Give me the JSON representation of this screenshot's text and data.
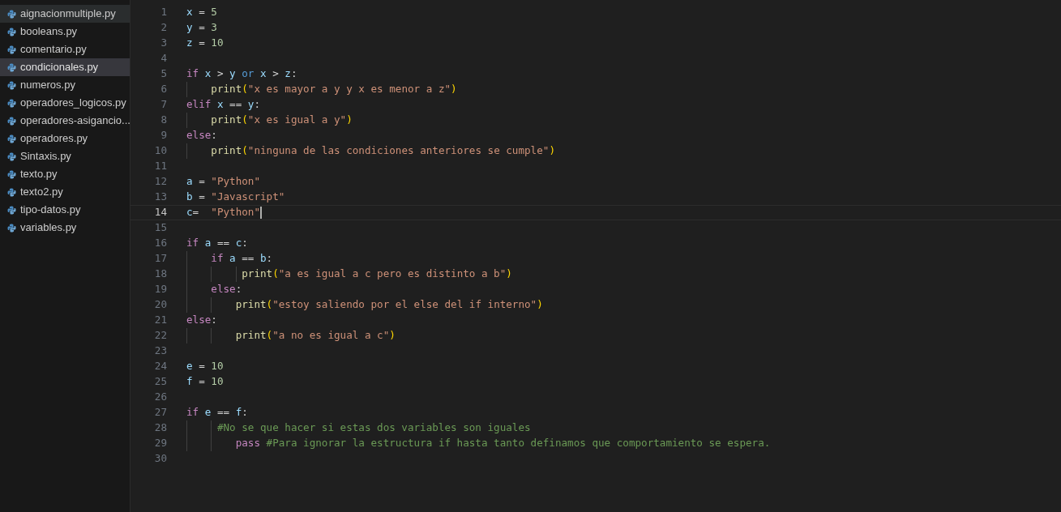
{
  "explorer": {
    "files": [
      {
        "name": "aignacionmultiple.py",
        "selected": false,
        "hovered": true
      },
      {
        "name": "booleans.py",
        "selected": false,
        "hovered": false
      },
      {
        "name": "comentario.py",
        "selected": false,
        "hovered": false
      },
      {
        "name": "condicionales.py",
        "selected": true,
        "hovered": false
      },
      {
        "name": "numeros.py",
        "selected": false,
        "hovered": false
      },
      {
        "name": "operadores_logicos.py",
        "selected": false,
        "hovered": false
      },
      {
        "name": "operadores-asigancio...",
        "selected": false,
        "hovered": false
      },
      {
        "name": "operadores.py",
        "selected": false,
        "hovered": false
      },
      {
        "name": "Sintaxis.py",
        "selected": false,
        "hovered": false
      },
      {
        "name": "texto.py",
        "selected": false,
        "hovered": false
      },
      {
        "name": "texto2.py",
        "selected": false,
        "hovered": false
      },
      {
        "name": "tipo-datos.py",
        "selected": false,
        "hovered": false
      },
      {
        "name": "variables.py",
        "selected": false,
        "hovered": false
      }
    ]
  },
  "editor": {
    "lines": [
      {
        "number": "1",
        "current": false,
        "tokens": [
          {
            "kind": "var",
            "text": "x"
          },
          {
            "kind": "op",
            "text": " = "
          },
          {
            "kind": "num",
            "text": "5"
          }
        ]
      },
      {
        "number": "2",
        "current": false,
        "tokens": [
          {
            "kind": "var",
            "text": "y"
          },
          {
            "kind": "op",
            "text": " = "
          },
          {
            "kind": "num",
            "text": "3"
          }
        ]
      },
      {
        "number": "3",
        "current": false,
        "tokens": [
          {
            "kind": "var",
            "text": "z"
          },
          {
            "kind": "op",
            "text": " = "
          },
          {
            "kind": "num",
            "text": "10"
          }
        ]
      },
      {
        "number": "4",
        "current": false
      },
      {
        "number": "5",
        "current": false,
        "tokens": [
          {
            "kind": "kw",
            "text": "if "
          },
          {
            "kind": "var",
            "text": "x"
          },
          {
            "kind": "op",
            "text": " > "
          },
          {
            "kind": "var",
            "text": "y "
          },
          {
            "kind": "kw2",
            "text": "or "
          },
          {
            "kind": "var",
            "text": "x"
          },
          {
            "kind": "op",
            "text": " > "
          },
          {
            "kind": "var",
            "text": "z"
          },
          {
            "kind": "op",
            "text": ":"
          }
        ]
      },
      {
        "number": "6",
        "current": false,
        "tokens": [
          {
            "kind": "fn",
            "text": "    print"
          },
          {
            "kind": "paren",
            "text": "("
          },
          {
            "kind": "str",
            "text": "\"x es mayor a y y x es menor a z\""
          },
          {
            "kind": "paren",
            "text": ")"
          }
        ]
      },
      {
        "number": "7",
        "current": false,
        "tokens": [
          {
            "kind": "kw",
            "text": "elif "
          },
          {
            "kind": "var",
            "text": "x"
          },
          {
            "kind": "op",
            "text": " == "
          },
          {
            "kind": "var",
            "text": "y"
          },
          {
            "kind": "op",
            "text": ":"
          }
        ]
      },
      {
        "number": "8",
        "current": false,
        "tokens": [
          {
            "kind": "fn",
            "text": "    print"
          },
          {
            "kind": "paren",
            "text": "("
          },
          {
            "kind": "str",
            "text": "\"x es igual a y\""
          },
          {
            "kind": "paren",
            "text": ")"
          }
        ]
      },
      {
        "number": "9",
        "current": false,
        "tokens": [
          {
            "kind": "kw",
            "text": "else"
          },
          {
            "kind": "op",
            "text": ":"
          }
        ]
      },
      {
        "number": "10",
        "current": false,
        "tokens": [
          {
            "kind": "fn",
            "text": "    print"
          },
          {
            "kind": "paren",
            "text": "("
          },
          {
            "kind": "str",
            "text": "\"ninguna de las condiciones anteriores se cumple\""
          },
          {
            "kind": "paren",
            "text": ")"
          }
        ]
      },
      {
        "number": "11",
        "current": false
      },
      {
        "number": "12",
        "current": false,
        "tokens": [
          {
            "kind": "var",
            "text": "a"
          },
          {
            "kind": "op",
            "text": " = "
          },
          {
            "kind": "str",
            "text": "\"Python\""
          }
        ]
      },
      {
        "number": "13",
        "current": false,
        "tokens": [
          {
            "kind": "var",
            "text": "b"
          },
          {
            "kind": "op",
            "text": " = "
          },
          {
            "kind": "str",
            "text": "\"Javascript\""
          }
        ]
      },
      {
        "number": "14",
        "current": true,
        "tokens": [
          {
            "kind": "var",
            "text": "c"
          },
          {
            "kind": "op",
            "text": "=  "
          },
          {
            "kind": "str",
            "text": "\"Python\""
          }
        ]
      },
      {
        "number": "15",
        "current": false
      },
      {
        "number": "16",
        "current": false,
        "tokens": [
          {
            "kind": "kw",
            "text": "if "
          },
          {
            "kind": "var",
            "text": "a"
          },
          {
            "kind": "op",
            "text": " == "
          },
          {
            "kind": "var",
            "text": "c"
          },
          {
            "kind": "op",
            "text": ":"
          }
        ]
      },
      {
        "number": "17",
        "current": false,
        "tokens": [
          {
            "kind": "kw",
            "text": "    if "
          },
          {
            "kind": "var",
            "text": "a"
          },
          {
            "kind": "op",
            "text": " == "
          },
          {
            "kind": "var",
            "text": "b"
          },
          {
            "kind": "op",
            "text": ":"
          }
        ]
      },
      {
        "number": "18",
        "current": false,
        "tokens": [
          {
            "kind": "fn",
            "text": "         print"
          },
          {
            "kind": "paren",
            "text": "("
          },
          {
            "kind": "str",
            "text": "\"a es igual a c pero es distinto a b\""
          },
          {
            "kind": "paren",
            "text": ")"
          }
        ]
      },
      {
        "number": "19",
        "current": false,
        "tokens": [
          {
            "kind": "kw",
            "text": "    else"
          },
          {
            "kind": "op",
            "text": ":"
          }
        ]
      },
      {
        "number": "20",
        "current": false,
        "tokens": [
          {
            "kind": "fn",
            "text": "        print"
          },
          {
            "kind": "paren",
            "text": "("
          },
          {
            "kind": "str",
            "text": "\"estoy saliendo por el else del if interno\""
          },
          {
            "kind": "paren",
            "text": ")"
          }
        ]
      },
      {
        "number": "21",
        "current": false,
        "tokens": [
          {
            "kind": "kw",
            "text": "else"
          },
          {
            "kind": "op",
            "text": ":"
          }
        ]
      },
      {
        "number": "22",
        "current": false,
        "tokens": [
          {
            "kind": "fn",
            "text": "        print"
          },
          {
            "kind": "paren",
            "text": "("
          },
          {
            "kind": "str",
            "text": "\"a no es igual a c\""
          },
          {
            "kind": "paren",
            "text": ")"
          }
        ]
      },
      {
        "number": "23",
        "current": false
      },
      {
        "number": "24",
        "current": false,
        "tokens": [
          {
            "kind": "var",
            "text": "e"
          },
          {
            "kind": "op",
            "text": " = "
          },
          {
            "kind": "num",
            "text": "10"
          }
        ]
      },
      {
        "number": "25",
        "current": false,
        "tokens": [
          {
            "kind": "var",
            "text": "f"
          },
          {
            "kind": "op",
            "text": " = "
          },
          {
            "kind": "num",
            "text": "10"
          }
        ]
      },
      {
        "number": "26",
        "current": false
      },
      {
        "number": "27",
        "current": false,
        "tokens": [
          {
            "kind": "kw",
            "text": "if "
          },
          {
            "kind": "var",
            "text": "e"
          },
          {
            "kind": "op",
            "text": " == "
          },
          {
            "kind": "var",
            "text": "f"
          },
          {
            "kind": "op",
            "text": ":"
          }
        ]
      },
      {
        "number": "28",
        "current": false,
        "tokens": [
          {
            "kind": "comment",
            "text": "     #No se que hacer si estas dos variables son iguales"
          }
        ]
      },
      {
        "number": "29",
        "current": false,
        "tokens": [
          {
            "kind": "kw",
            "text": "        pass "
          },
          {
            "kind": "comment",
            "text": "#Para ignorar la estructura if hasta tanto definamos que comportamiento se espera."
          }
        ]
      },
      {
        "number": "30",
        "current": false
      }
    ]
  }
}
